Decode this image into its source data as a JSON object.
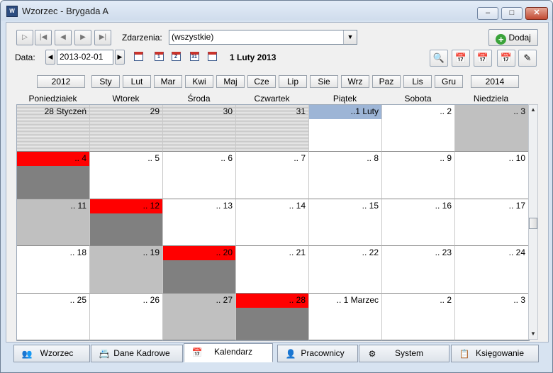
{
  "window": {
    "title": "Wzorzec - Brygada A",
    "controls": {
      "minimize": "–",
      "maximize": "□",
      "close": "✕"
    }
  },
  "toolbar": {
    "nav_buttons": [
      {
        "name": "play-button",
        "glyph": "▷"
      },
      {
        "name": "first-button",
        "glyph": "|◀"
      },
      {
        "name": "prev-button",
        "glyph": "◀"
      },
      {
        "name": "next-button",
        "glyph": "▶"
      },
      {
        "name": "last-button",
        "glyph": "▶|"
      }
    ],
    "events_label": "Zdarzenia:",
    "events_value": "(wszystkie)",
    "add_label": "Dodaj",
    "date_label": "Data:",
    "date_value": "2013-02-01",
    "current_date_text": "1 Luty 2013",
    "view_icons": [
      {
        "name": "month-grid-icon",
        "text": ""
      },
      {
        "name": "day-view-icon",
        "text": "1"
      },
      {
        "name": "week-view-icon",
        "text": "Z"
      },
      {
        "name": "month-view-icon",
        "text": "31"
      },
      {
        "name": "list-view-icon",
        "text": ""
      }
    ],
    "right_icons": [
      {
        "name": "search-icon",
        "text": "🔍"
      },
      {
        "name": "calendar-user-icon",
        "text": "📅"
      },
      {
        "name": "calendar-clock-icon",
        "text": "📅"
      },
      {
        "name": "calendar-grid-icon",
        "text": "📅"
      },
      {
        "name": "pencil-icon",
        "text": "✎"
      }
    ]
  },
  "months": {
    "prev_year": "2012",
    "next_year": "2014",
    "items": [
      "Sty",
      "Lut",
      "Mar",
      "Kwi",
      "Maj",
      "Cze",
      "Lip",
      "Sie",
      "Wrz",
      "Paz",
      "Lis",
      "Gru"
    ]
  },
  "days": [
    "Poniedziałek",
    "Wtorek",
    "Środa",
    "Czwartek",
    "Piątek",
    "Sobota",
    "Niedziela"
  ],
  "weeks": [
    [
      {
        "label": "28 Styczeń",
        "style": "hatch"
      },
      {
        "label": "29",
        "style": "hatch"
      },
      {
        "label": "30",
        "style": "hatch"
      },
      {
        "label": "31",
        "style": "hatch"
      },
      {
        "label": "..1 Luty",
        "style": "today"
      },
      {
        "label": ".. 2",
        "style": "white"
      },
      {
        "label": ".. 3",
        "style": "lightgray"
      }
    ],
    [
      {
        "label": ".. 4",
        "style": "red-dark"
      },
      {
        "label": ".. 5",
        "style": "white"
      },
      {
        "label": ".. 6",
        "style": "white"
      },
      {
        "label": ".. 7",
        "style": "white"
      },
      {
        "label": ".. 8",
        "style": "white"
      },
      {
        "label": ".. 9",
        "style": "white"
      },
      {
        "label": ".. 10",
        "style": "white"
      }
    ],
    [
      {
        "label": ".. 11",
        "style": "lightgray"
      },
      {
        "label": ".. 12",
        "style": "red-dark"
      },
      {
        "label": ".. 13",
        "style": "white"
      },
      {
        "label": ".. 14",
        "style": "white"
      },
      {
        "label": ".. 15",
        "style": "white"
      },
      {
        "label": ".. 16",
        "style": "white"
      },
      {
        "label": ".. 17",
        "style": "white"
      }
    ],
    [
      {
        "label": ".. 18",
        "style": "white"
      },
      {
        "label": ".. 19",
        "style": "lightgray"
      },
      {
        "label": ".. 20",
        "style": "red-dark"
      },
      {
        "label": ".. 21",
        "style": "white"
      },
      {
        "label": ".. 22",
        "style": "white"
      },
      {
        "label": ".. 23",
        "style": "white"
      },
      {
        "label": ".. 24",
        "style": "white"
      }
    ],
    [
      {
        "label": ".. 25",
        "style": "white"
      },
      {
        "label": ".. 26",
        "style": "white"
      },
      {
        "label": ".. 27",
        "style": "lightgray"
      },
      {
        "label": ".. 28",
        "style": "red-dark"
      },
      {
        "label": ".. 1 Marzec",
        "style": "white"
      },
      {
        "label": ".. 2",
        "style": "white"
      },
      {
        "label": ".. 3",
        "style": "white"
      }
    ]
  ],
  "tabs": [
    {
      "name": "tab-wzorzec",
      "icon": "users-icon",
      "glyph": "👥",
      "label": "Wzorzec",
      "active": false
    },
    {
      "name": "tab-dane-kadrowe",
      "icon": "id-card-icon",
      "glyph": "📇",
      "label": "Dane Kadrowe",
      "active": false
    },
    {
      "name": "tab-kalendarz",
      "icon": "calendar-icon",
      "glyph": "📅",
      "label": "Kalendarz",
      "active": true
    },
    {
      "name": "tab-pracownicy",
      "icon": "user-icon",
      "glyph": "👤",
      "label": "Pracownicy",
      "active": false
    },
    {
      "name": "tab-system",
      "icon": "system-tree-icon",
      "glyph": "⚙",
      "label": "System",
      "active": false
    },
    {
      "name": "tab-ksiegowanie",
      "icon": "ledger-icon",
      "glyph": "📋",
      "label": "Księgowanie",
      "active": false
    }
  ],
  "colors": {
    "red": "#ff0000",
    "dark": "#808080",
    "lightgray": "#c0c0c0",
    "today": "#9db5d6",
    "add_green": "#3aa33a"
  }
}
